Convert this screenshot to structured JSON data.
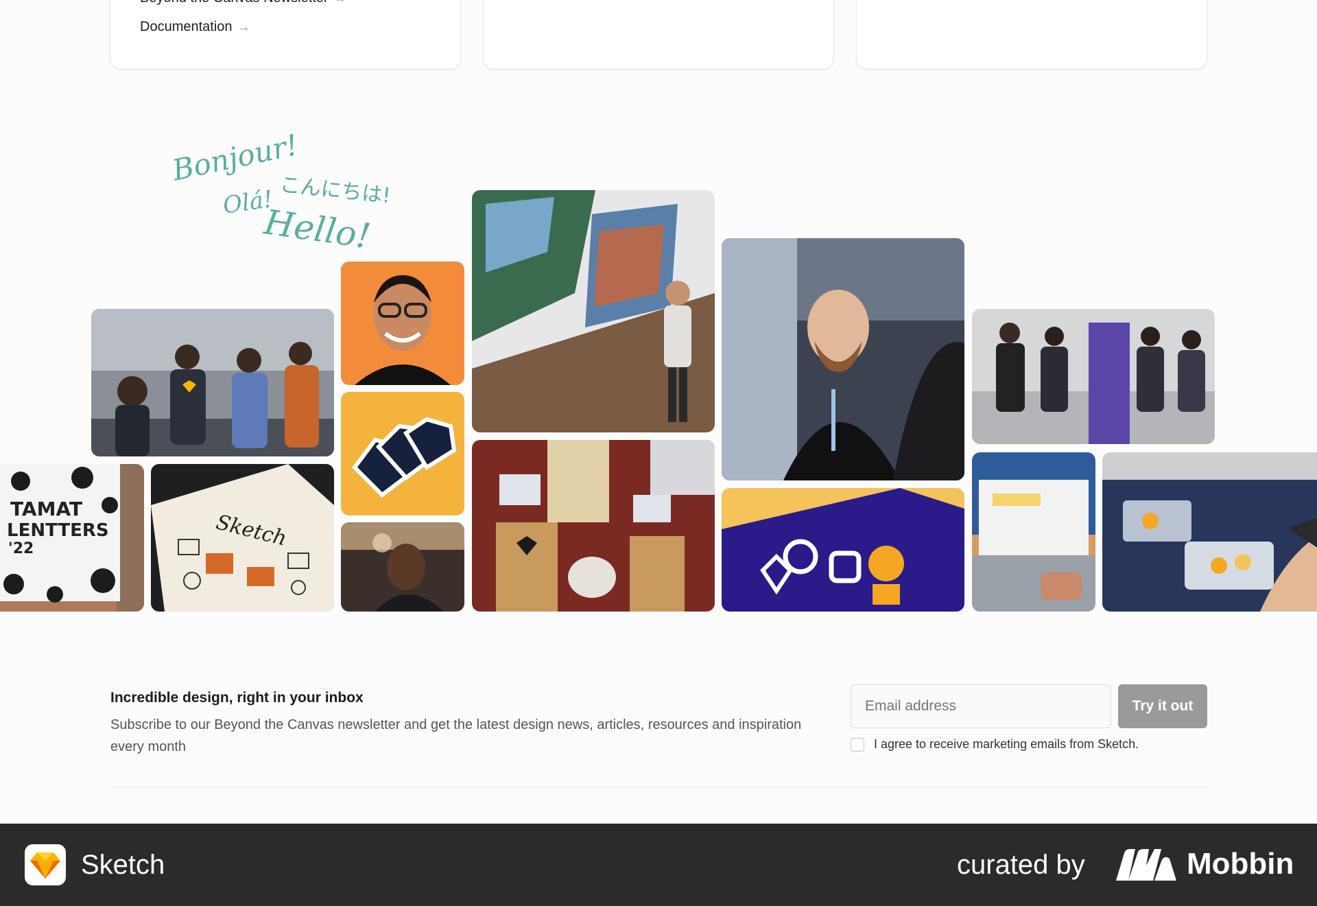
{
  "cards": {
    "newsletter_link": "Beyond the Canvas Newsletter",
    "docs_link": "Documentation",
    "arrow": "→"
  },
  "greetings": {
    "bonjour": "Bonjour!",
    "ola": "Olá!",
    "konnichiwa": "こんにちは!",
    "hello": "Hello!"
  },
  "photos": [
    "team-sharing-sketch-merch",
    "smiling-man-portrait",
    "sketch-stickers",
    "smiling-man-at-event",
    "speaker-gran-canaria-copenhagen",
    "sketch-event-booths",
    "designer-at-screen",
    "digital-design-toolkit-booklet",
    "team-photo-japan",
    "laptop-sketch-website",
    "sketch-pins-handout",
    "tamat-lentters-sign",
    "sketch-illustrated-zine"
  ],
  "newsletter": {
    "title": "Incredible design, right in your inbox",
    "description": "Subscribe to our Beyond the Canvas newsletter and get the latest design news, articles, resources and inspiration every month",
    "email_placeholder": "Email address",
    "submit_label": "Try it out",
    "consent_label": "I agree to receive marketing emails from Sketch."
  },
  "footer": {
    "app_name": "Sketch",
    "curated_by": "curated by",
    "curator": "Mobbin"
  },
  "colors": {
    "greeting": "#5aaea0",
    "footer_bg": "#2b2b2b",
    "button_disabled": "#9a9a9a",
    "sketch_orange": "#f7b500"
  }
}
